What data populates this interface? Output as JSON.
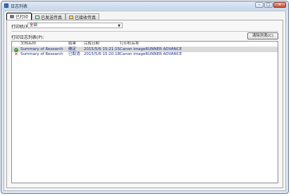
{
  "window": {
    "title": "日志列表"
  },
  "tabs": [
    {
      "label": "已打印",
      "icon": "printer-icon"
    },
    {
      "label": "已发送传真",
      "icon": "fax-doc-icon"
    },
    {
      "label": "已接收传真",
      "icon": "received-fax-icon"
    }
  ],
  "filter": {
    "label": "打印机(P):",
    "value": "全部"
  },
  "list": {
    "label": "打印日志列表(P):",
    "clear_button": "清除列表(C)",
    "headers": [
      "文档名称",
      "结果",
      "完成日期",
      "打印机名称"
    ],
    "rows": [
      {
        "status": "ok",
        "status_icon": "check-icon",
        "doc": "Summary of Research",
        "result": "确定",
        "date": "2015/5/6 15:21:15",
        "printer": "Canon imageRUNNER ADVANCE"
      },
      {
        "status": "cancelled",
        "status_icon": "x-icon",
        "doc": "Summary of Research",
        "result": "已取消",
        "date": "2015/5/6 15:20:18",
        "printer": "Canon imageRUNNER ADVANCE"
      }
    ]
  }
}
